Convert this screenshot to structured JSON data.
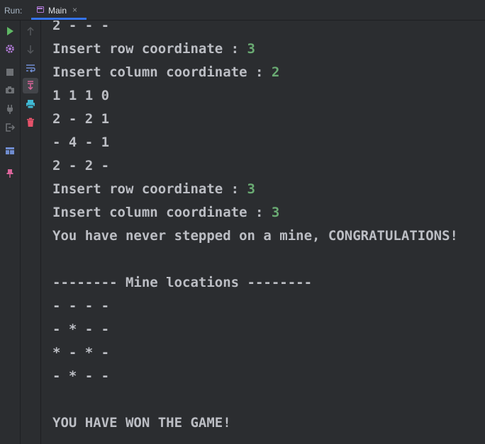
{
  "run_panel": {
    "label": "Run:",
    "tab": {
      "label": "Main",
      "close": "×"
    }
  },
  "icons": {
    "left_toolbar": [
      "run-icon",
      "settings-icon",
      "stop-icon",
      "camera-icon",
      "plug-icon",
      "exit-icon",
      "layout-icon",
      "pin-icon"
    ],
    "second_toolbar": [
      "arrow-up-icon",
      "arrow-down-icon",
      "soft-wrap-icon",
      "scroll-to-end-icon",
      "print-icon",
      "trash-icon"
    ]
  },
  "colors": {
    "background": "#2b2d30",
    "text": "#bcbec4",
    "user_input": "#6aab73",
    "accent": "#3574f0"
  },
  "console": {
    "lines": [
      {
        "text": "2 - - -"
      },
      {
        "text": "Insert row coordinate : ",
        "input": "3"
      },
      {
        "text": "Insert column coordinate : ",
        "input": "2"
      },
      {
        "text": "1 1 1 0"
      },
      {
        "text": "2 - 2 1"
      },
      {
        "text": "- 4 - 1"
      },
      {
        "text": "2 - 2 -"
      },
      {
        "text": "Insert row coordinate : ",
        "input": "3"
      },
      {
        "text": "Insert column coordinate : ",
        "input": "3"
      },
      {
        "text": "You have never stepped on a mine, CONGRATULATIONS!"
      },
      {
        "text": ""
      },
      {
        "text": "-------- Mine locations --------"
      },
      {
        "text": "- - - -"
      },
      {
        "text": "- * - -"
      },
      {
        "text": "* - * -"
      },
      {
        "text": "- * - -"
      },
      {
        "text": ""
      },
      {
        "text": "YOU HAVE WON THE GAME!"
      }
    ]
  }
}
